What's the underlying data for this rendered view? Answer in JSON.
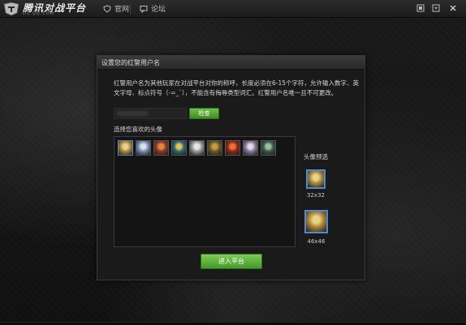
{
  "app": {
    "brand": "腾讯对战平台",
    "brand_url": "DZ.QQ.COM",
    "nav": [
      {
        "label": "官网",
        "icon": "shield-icon"
      },
      {
        "label": "论坛",
        "icon": "chat-icon"
      }
    ],
    "window_controls": [
      "skin-icon",
      "menu-dropdown-icon",
      "close-icon"
    ]
  },
  "dialog": {
    "title": "设置您的红警用户名",
    "description": "红警用户名为其他玩家在对战平台对你的称呼，长度必须在6-15个字符，允许输入数字、英文字母、标点符号（-=_`），不能含有侮辱类型词汇。红警用户名唯一且不可更改。",
    "name_input_value": "",
    "check_button": "检查",
    "choose_avatar_label": "选择您喜欢的头像",
    "avatars": [
      {
        "name": "avatar-1",
        "color": "#b08a3a",
        "accent": "#e8d28a"
      },
      {
        "name": "avatar-2",
        "color": "#7d8fb0",
        "accent": "#d8e2f2"
      },
      {
        "name": "avatar-3",
        "color": "#8a3a2a",
        "accent": "#e0883a"
      },
      {
        "name": "avatar-4",
        "color": "#2a6a7a",
        "accent": "#e6c24a"
      },
      {
        "name": "avatar-5",
        "color": "#9a9a9a",
        "accent": "#e8e8e8"
      },
      {
        "name": "avatar-6",
        "color": "#6a5a2a",
        "accent": "#c89a3a"
      },
      {
        "name": "avatar-7",
        "color": "#8a2a1a",
        "accent": "#f0702a"
      },
      {
        "name": "avatar-8",
        "color": "#8a7a9a",
        "accent": "#e0d8e8"
      },
      {
        "name": "avatar-9",
        "color": "#3a5a4a",
        "accent": "#9ac0a0"
      }
    ],
    "selected_avatar": 0,
    "preview_label": "头像预选",
    "preview_small_size": "32x32",
    "preview_large_size": "46x46",
    "enter_button": "进入平台"
  },
  "colors": {
    "accent_green": "#4fa52f",
    "selection_blue": "#4a8ad6"
  }
}
